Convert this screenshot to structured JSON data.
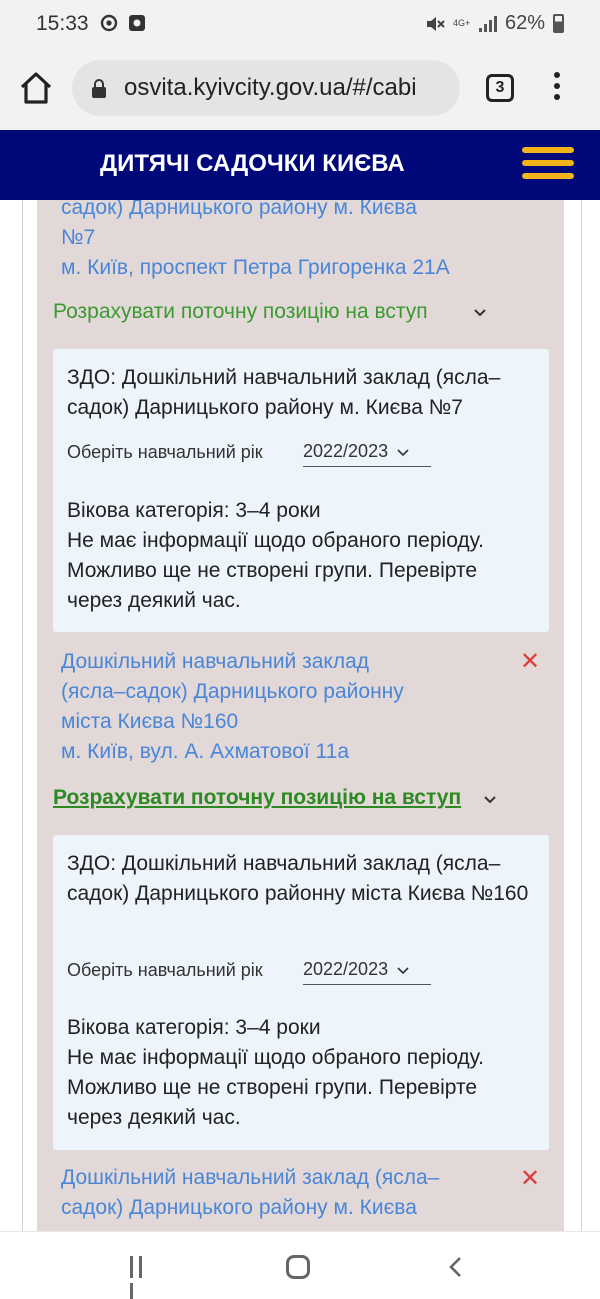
{
  "status_bar": {
    "time": "15:33",
    "network": "4G+",
    "battery": "62%",
    "icons": [
      "at-sign-icon",
      "screen-record-icon",
      "mute-icon",
      "signal-icon",
      "battery-icon"
    ]
  },
  "browser": {
    "url": "osvita.kyivcity.gov.ua/#/cabi",
    "tab_count": "3"
  },
  "header": {
    "title": "ДИТЯЧІ САДОЧКИ КИЄВА"
  },
  "entries": [
    {
      "name_line1": "садок) Дарницького району м. Києва",
      "name_line2": "№7",
      "address": "м. Київ, проспект Петра Григоренка 21А",
      "calc_link": "Розрахувати поточну позицію на вступ",
      "card": {
        "title": "ЗДО: Дошкільний навчальний заклад (ясла–садок) Дарницького району м. Києва №7",
        "year_label": "Оберіть навчальний рік",
        "year_value": "2022/2023",
        "age_category": "Вікова категорія: 3–4 роки",
        "message": "Не має інформації щодо обраного періоду. Можливо ще не створені групи. Перевірте через деякий час."
      }
    },
    {
      "name_line1": "Дошкільний навчальний заклад",
      "name_line2": "(ясла–садок) Дарницького районну",
      "name_line3": "міста Києва №160",
      "address": "м. Київ, вул. А. Ахматової 11а",
      "calc_link": "Розрахувати поточну позицію на вступ",
      "card": {
        "title": "ЗДО: Дошкільний навчальний заклад (ясла–садок) Дарницького районну міста Києва №160",
        "year_label": "Оберіть навчальний рік",
        "year_value": "2022/2023",
        "age_category": "Вікова категорія: 3–4 роки",
        "message": "Не має інформації щодо обраного періоду. Можливо ще не створені групи. Перевірте через деякий час."
      }
    },
    {
      "name_line1": "Дошкільний навчальний заклад (ясла–",
      "name_line2": "садок) Дарницького району м. Києва"
    }
  ],
  "remove_symbol": "✕",
  "colors": {
    "header_bg": "#00087a",
    "hamburger": "#f2b418",
    "link": "#4a86d8",
    "calc_link": "#3a9a2f",
    "remove": "#e03b3b",
    "list_bg": "#e2d8d8",
    "card_bg": "#eef4fb"
  }
}
